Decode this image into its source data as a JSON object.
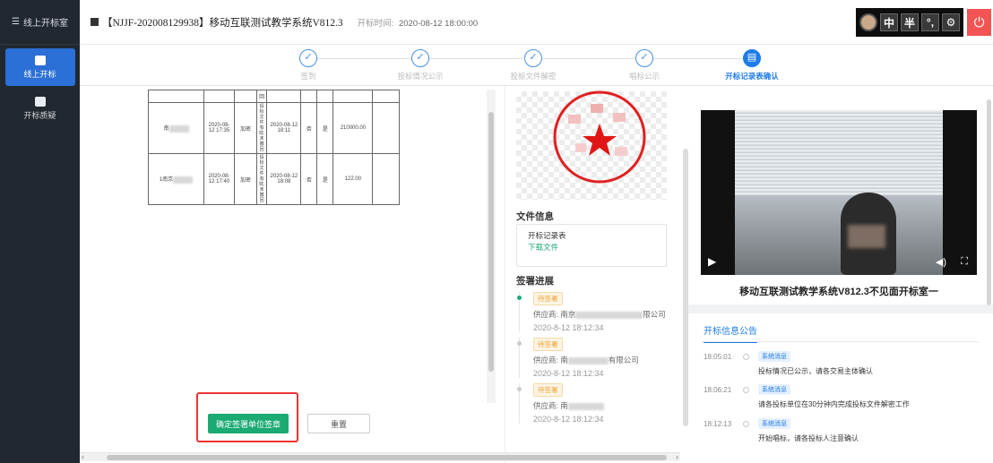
{
  "sidebar": {
    "header_label": "线上开标室",
    "items": [
      {
        "label": "线上开标",
        "icon": "chat-icon",
        "active": true
      },
      {
        "label": "开标质疑",
        "icon": "ticket-icon",
        "active": false
      }
    ]
  },
  "topbar": {
    "title": "【NJJF-202008129938】移动互联测试教学系统V812.3",
    "open_time_label": "开标时间:",
    "open_time_value": "2020-08-12 18:00:00",
    "tools": {
      "zh_label": "中",
      "half_label": "半"
    }
  },
  "steps": [
    {
      "label": "签到",
      "done": true
    },
    {
      "label": "投标情况公示",
      "done": true
    },
    {
      "label": "投标文件解密",
      "done": true
    },
    {
      "label": "唱标公示",
      "done": true
    },
    {
      "label": "开标记录表确认",
      "done": false,
      "active": true
    }
  ],
  "record_table": {
    "rows": [
      {
        "company": "南",
        "time": "2020-08-12 17:35",
        "method": "加密",
        "status": "投标文件有效,未撤回",
        "time2": "2020-08-12 18:11",
        "c1": "否",
        "c2": "是",
        "amount": "210000.00"
      },
      {
        "company": "1南京",
        "time": "2020-08-12 17:40",
        "method": "加密",
        "status": "投标文件有效,未撤回",
        "time2": "2020-08-12 18:08",
        "c1": "否",
        "c2": "是",
        "amount": "122.00"
      }
    ],
    "top_fragment": "回"
  },
  "buttons": {
    "confirm": "确定签署单位签章",
    "reset": "重置"
  },
  "file_info": {
    "title": "文件信息",
    "file_name": "开标记录表",
    "download": "下载文件"
  },
  "sign_progress": {
    "title": "签署进展",
    "items": [
      {
        "status": "待签署",
        "supplier": "供应商: 南京",
        "supplier_suffix": "限公司",
        "date": "2020-8-12 18:12:34"
      },
      {
        "status": "待签署",
        "supplier": "供应商: 南",
        "supplier_suffix": "有限公司",
        "date": "2020-8-12 18:12:34"
      },
      {
        "status": "待签署",
        "supplier": "供应商: 南",
        "supplier_suffix": "",
        "date": "2020-8-12 18:12:34"
      }
    ]
  },
  "video": {
    "room_name": "移动互联测试教学系统V812.3不见面开标室一"
  },
  "announcements": {
    "tab": "开标信息公告",
    "items": [
      {
        "time": "18:05:01",
        "tag": "系统消息",
        "text": "投标情况已公示，请各交易主体确认"
      },
      {
        "time": "18:06:21",
        "tag": "系统消息",
        "text": "请各投标单位在30分钟内完成投标文件解密工作"
      },
      {
        "time": "18:12:13",
        "tag": "系统消息",
        "text": "开始唱标，请各投标人注意确认"
      }
    ]
  },
  "colors": {
    "sidebar_bg": "#22282f",
    "accent_blue": "#1e7be8",
    "confirm_green": "#1aaa72",
    "power_red": "#f25454",
    "highlight_red": "#e33333"
  }
}
